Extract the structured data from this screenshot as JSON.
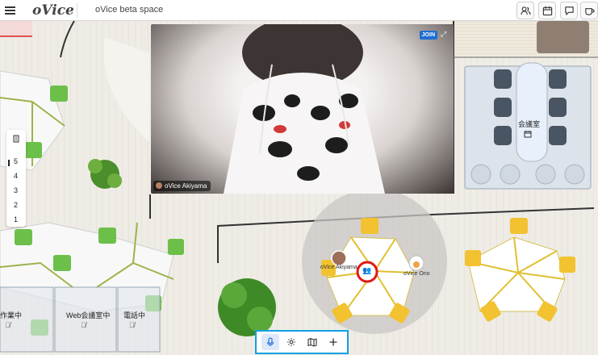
{
  "header": {
    "brand": "oVice",
    "space_name": "oVice beta space",
    "icons": [
      "people-icon",
      "calendar-icon",
      "chat-icon",
      "coffee-icon"
    ]
  },
  "video": {
    "participant": "oVice Akiyama",
    "join_label": "JOIN",
    "expand_icon": "expand-icon"
  },
  "floor_selector": {
    "icon": "building-icon",
    "floors": [
      "5",
      "4",
      "3",
      "2",
      "1"
    ],
    "active": "5"
  },
  "rooms": {
    "meeting_room": "会議室",
    "working": "作業中",
    "web_meeting": "Web会議室中",
    "on_call": "電話中"
  },
  "avatars": {
    "akiyama": "oVice Akiyama",
    "ono": "oVice Ono"
  },
  "toolbar": {
    "buttons": [
      "microphone-icon",
      "settings-icon",
      "map-icon",
      "plus-icon"
    ],
    "active": "microphone-icon"
  },
  "colors": {
    "accent_blue": "#12a0e2",
    "highlight_red": "#e01818",
    "chair_yellow": "#f2c230",
    "chair_green": "#6cc04a"
  }
}
